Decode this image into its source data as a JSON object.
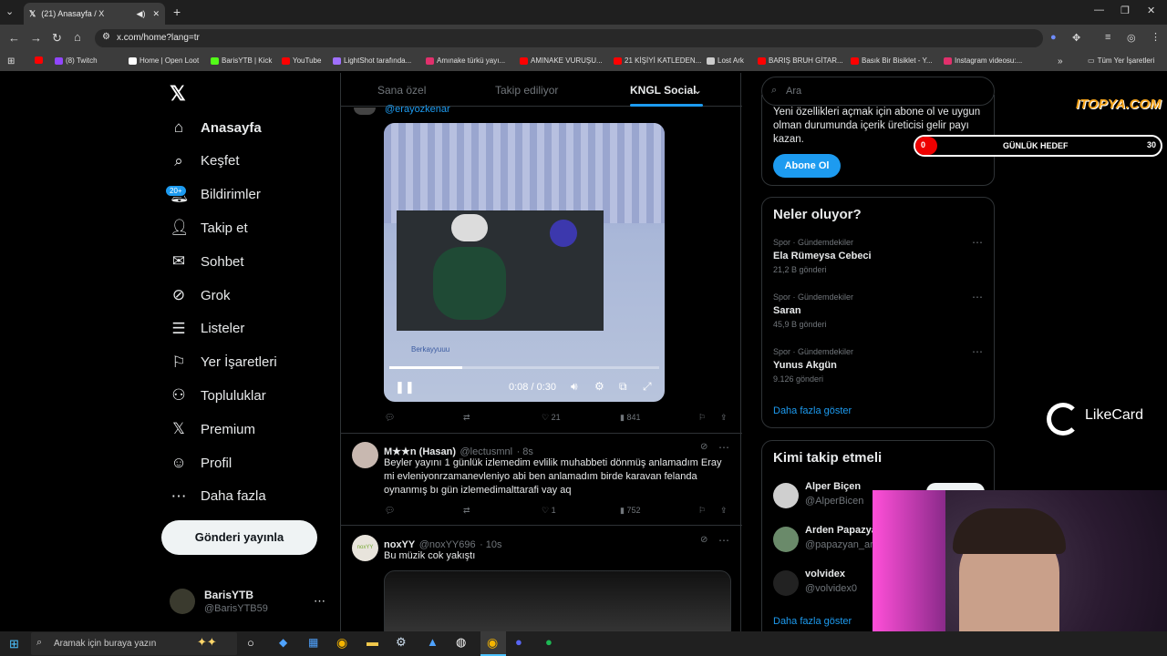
{
  "browser": {
    "tab_title": "(21) Anasayfa / X",
    "url": "x.com/home?lang=tr",
    "bookmarks": [
      {
        "label": "(8) Twitch",
        "color": "#9146ff"
      },
      {
        "label": "Home | Open Loot",
        "color": "#ffffff"
      },
      {
        "label": "BarisYTB | Kick",
        "color": "#53fc18"
      },
      {
        "label": "YouTube",
        "color": "#ff0000"
      },
      {
        "label": "LightShot tarafında...",
        "color": "#a070ff"
      },
      {
        "label": "Amınake türkü yayı...",
        "color": "#e1306c"
      },
      {
        "label": "AMINAKE VURUŞU...",
        "color": "#ff0000"
      },
      {
        "label": "21 KİŞİYİ KATLEDEN...",
        "color": "#ff0000"
      },
      {
        "label": "Lost Ark",
        "color": "#cccccc"
      },
      {
        "label": "BARIŞ BRUH GİTAR...",
        "color": "#ff0000"
      },
      {
        "label": "Basık Bir Bisiklet - Y...",
        "color": "#ff0000"
      },
      {
        "label": "Instagram videosu:...",
        "color": "#e1306c"
      }
    ],
    "all_bookmarks": "Tüm Yer İşaretleri"
  },
  "sidebar": {
    "items": [
      {
        "label": "Anasayfa",
        "icon": "home-icon",
        "glyph": "⌂"
      },
      {
        "label": "Keşfet",
        "icon": "search-icon",
        "glyph": "⌕"
      },
      {
        "label": "Bildirimler",
        "icon": "bell-icon",
        "glyph": "🔔︎"
      },
      {
        "label": "Takip et",
        "icon": "add-user-icon",
        "glyph": "👤︎"
      },
      {
        "label": "Sohbet",
        "icon": "mail-icon",
        "glyph": "✉"
      },
      {
        "label": "Grok",
        "icon": "grok-icon",
        "glyph": "⊘"
      },
      {
        "label": "Listeler",
        "icon": "list-icon",
        "glyph": "☰"
      },
      {
        "label": "Yer İşaretleri",
        "icon": "bookmark-icon",
        "glyph": "⚐"
      },
      {
        "label": "Topluluklar",
        "icon": "communities-icon",
        "glyph": "⚇"
      },
      {
        "label": "Premium",
        "icon": "x-logo-icon",
        "glyph": "𝕏"
      },
      {
        "label": "Profil",
        "icon": "profile-icon",
        "glyph": "☺"
      },
      {
        "label": "Daha fazla",
        "icon": "more-icon",
        "glyph": "⋯"
      }
    ],
    "badge": "20+",
    "post_button": "Gönderi yayınla",
    "user": {
      "name": "BarisYTB",
      "handle": "@BarisYTB59"
    }
  },
  "feed": {
    "tabs": [
      "Sana özel",
      "Takip ediliyor",
      "KNGL Social"
    ],
    "top_mention": "@erayozkenar",
    "video": {
      "time": "0:08 / 0:30",
      "overlay_name": "Berkayyuuu"
    },
    "tweet0_stats": {
      "likes": "21",
      "views": "841"
    },
    "tweets": [
      {
        "name": "M★★n (Hasan)",
        "handle": "@lectusmnl",
        "time": "· 8s",
        "text": "Beyler yayını 1 günlük izlemedim evlilik muhabbeti dönmüş anlamadım Eray mi evleniyonrzamanevleniyo abi ben anlamadım birde karavan felanda oynanmış bı gün izlemedimalttarafi vay aq",
        "likes": "1",
        "views": "752"
      },
      {
        "name": "noxYY",
        "handle": "@noxYY696",
        "time": "· 10s",
        "text": "Bu müzik cok yakıştı"
      }
    ]
  },
  "right": {
    "search_placeholder": "Ara",
    "premium_text": "Yeni özellikleri açmak için abone ol ve uygun olman durumunda içerik üreticisi gelir payı kazan.",
    "subscribe": "Abone Ol",
    "trends_title": "Neler oluyor?",
    "trends": [
      {
        "cat": "Spor · Gündemdekiler",
        "name": "Ela Rümeysa Cebeci",
        "count": "21,2 B gönderi"
      },
      {
        "cat": "Spor · Gündemdekiler",
        "name": "Saran",
        "count": "45,9 B gönderi"
      },
      {
        "cat": "Spor · Gündemdekiler",
        "name": "Yunus Akgün",
        "count": "9.126 gönderi"
      }
    ],
    "show_more": "Daha fazla göster",
    "follow_title": "Kimi takip etmeli",
    "follow": [
      {
        "name": "Alper Biçen",
        "handle": "@AlperBicen"
      },
      {
        "name": "Arden Papazya",
        "handle": "@papazyan_ar"
      },
      {
        "name": "volvidex",
        "handle": "@volvidex0"
      }
    ],
    "show_more2": "Daha fazla göster"
  },
  "overlay": {
    "goal_left": "0",
    "goal_label": "GÜNLÜK HEDEF",
    "goal_right": "30",
    "itopya": "ITOPYA.COM",
    "likecard": "LikeCard"
  },
  "taskbar": {
    "search": "Aramak için buraya yazın"
  }
}
